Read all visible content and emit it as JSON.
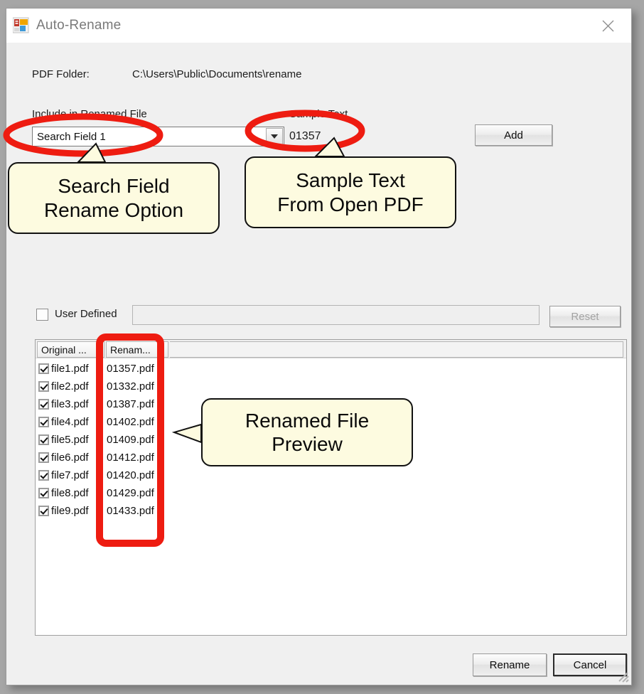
{
  "window": {
    "title": "Auto-Rename",
    "icon": "winforms-app-icon",
    "close_label": "close-icon"
  },
  "form": {
    "pdf_folder_label": "PDF Folder:",
    "pdf_folder_value": "C:\\Users\\Public\\Documents\\rename",
    "include_label": "Include in Renamed File",
    "sample_label": "Sample Text",
    "combo_value": "Search Field 1",
    "sample_value": "01357",
    "add_label": "Add",
    "user_defined_label": "User Defined",
    "user_defined_checked": false,
    "user_defined_value": "",
    "reset_label": "Reset",
    "reset_disabled": true,
    "rename_label": "Rename",
    "cancel_label": "Cancel"
  },
  "listview": {
    "columns": [
      "Original ...",
      "Renam..."
    ],
    "rows": [
      {
        "checked": true,
        "original": "file1.pdf",
        "renamed": "01357.pdf"
      },
      {
        "checked": true,
        "original": "file2.pdf",
        "renamed": "01332.pdf"
      },
      {
        "checked": true,
        "original": "file3.pdf",
        "renamed": "01387.pdf"
      },
      {
        "checked": true,
        "original": "file4.pdf",
        "renamed": "01402.pdf"
      },
      {
        "checked": true,
        "original": "file5.pdf",
        "renamed": "01409.pdf"
      },
      {
        "checked": true,
        "original": "file6.pdf",
        "renamed": "01412.pdf"
      },
      {
        "checked": true,
        "original": "file7.pdf",
        "renamed": "01420.pdf"
      },
      {
        "checked": true,
        "original": "file8.pdf",
        "renamed": "01429.pdf"
      },
      {
        "checked": true,
        "original": "file9.pdf",
        "renamed": "01433.pdf"
      }
    ]
  },
  "annotations": {
    "highlight_color": "#ee1c11",
    "callout_fill": "#fdfbe0",
    "callouts": [
      {
        "line1": "Search Field",
        "line2": "Rename Option"
      },
      {
        "line1": "Sample Text",
        "line2": "From Open PDF"
      },
      {
        "line1": "Renamed File",
        "line2": "Preview"
      }
    ]
  }
}
